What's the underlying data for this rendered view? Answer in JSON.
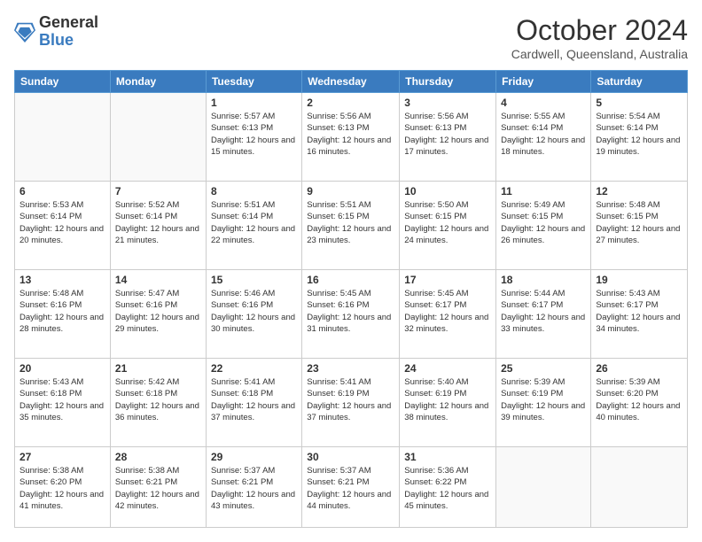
{
  "logo": {
    "general": "General",
    "blue": "Blue"
  },
  "header": {
    "month": "October 2024",
    "location": "Cardwell, Queensland, Australia"
  },
  "days_of_week": [
    "Sunday",
    "Monday",
    "Tuesday",
    "Wednesday",
    "Thursday",
    "Friday",
    "Saturday"
  ],
  "weeks": [
    [
      {
        "day": "",
        "info": ""
      },
      {
        "day": "",
        "info": ""
      },
      {
        "day": "1",
        "info": "Sunrise: 5:57 AM\nSunset: 6:13 PM\nDaylight: 12 hours and 15 minutes."
      },
      {
        "day": "2",
        "info": "Sunrise: 5:56 AM\nSunset: 6:13 PM\nDaylight: 12 hours and 16 minutes."
      },
      {
        "day": "3",
        "info": "Sunrise: 5:56 AM\nSunset: 6:13 PM\nDaylight: 12 hours and 17 minutes."
      },
      {
        "day": "4",
        "info": "Sunrise: 5:55 AM\nSunset: 6:14 PM\nDaylight: 12 hours and 18 minutes."
      },
      {
        "day": "5",
        "info": "Sunrise: 5:54 AM\nSunset: 6:14 PM\nDaylight: 12 hours and 19 minutes."
      }
    ],
    [
      {
        "day": "6",
        "info": "Sunrise: 5:53 AM\nSunset: 6:14 PM\nDaylight: 12 hours and 20 minutes."
      },
      {
        "day": "7",
        "info": "Sunrise: 5:52 AM\nSunset: 6:14 PM\nDaylight: 12 hours and 21 minutes."
      },
      {
        "day": "8",
        "info": "Sunrise: 5:51 AM\nSunset: 6:14 PM\nDaylight: 12 hours and 22 minutes."
      },
      {
        "day": "9",
        "info": "Sunrise: 5:51 AM\nSunset: 6:15 PM\nDaylight: 12 hours and 23 minutes."
      },
      {
        "day": "10",
        "info": "Sunrise: 5:50 AM\nSunset: 6:15 PM\nDaylight: 12 hours and 24 minutes."
      },
      {
        "day": "11",
        "info": "Sunrise: 5:49 AM\nSunset: 6:15 PM\nDaylight: 12 hours and 26 minutes."
      },
      {
        "day": "12",
        "info": "Sunrise: 5:48 AM\nSunset: 6:15 PM\nDaylight: 12 hours and 27 minutes."
      }
    ],
    [
      {
        "day": "13",
        "info": "Sunrise: 5:48 AM\nSunset: 6:16 PM\nDaylight: 12 hours and 28 minutes."
      },
      {
        "day": "14",
        "info": "Sunrise: 5:47 AM\nSunset: 6:16 PM\nDaylight: 12 hours and 29 minutes."
      },
      {
        "day": "15",
        "info": "Sunrise: 5:46 AM\nSunset: 6:16 PM\nDaylight: 12 hours and 30 minutes."
      },
      {
        "day": "16",
        "info": "Sunrise: 5:45 AM\nSunset: 6:16 PM\nDaylight: 12 hours and 31 minutes."
      },
      {
        "day": "17",
        "info": "Sunrise: 5:45 AM\nSunset: 6:17 PM\nDaylight: 12 hours and 32 minutes."
      },
      {
        "day": "18",
        "info": "Sunrise: 5:44 AM\nSunset: 6:17 PM\nDaylight: 12 hours and 33 minutes."
      },
      {
        "day": "19",
        "info": "Sunrise: 5:43 AM\nSunset: 6:17 PM\nDaylight: 12 hours and 34 minutes."
      }
    ],
    [
      {
        "day": "20",
        "info": "Sunrise: 5:43 AM\nSunset: 6:18 PM\nDaylight: 12 hours and 35 minutes."
      },
      {
        "day": "21",
        "info": "Sunrise: 5:42 AM\nSunset: 6:18 PM\nDaylight: 12 hours and 36 minutes."
      },
      {
        "day": "22",
        "info": "Sunrise: 5:41 AM\nSunset: 6:18 PM\nDaylight: 12 hours and 37 minutes."
      },
      {
        "day": "23",
        "info": "Sunrise: 5:41 AM\nSunset: 6:19 PM\nDaylight: 12 hours and 37 minutes."
      },
      {
        "day": "24",
        "info": "Sunrise: 5:40 AM\nSunset: 6:19 PM\nDaylight: 12 hours and 38 minutes."
      },
      {
        "day": "25",
        "info": "Sunrise: 5:39 AM\nSunset: 6:19 PM\nDaylight: 12 hours and 39 minutes."
      },
      {
        "day": "26",
        "info": "Sunrise: 5:39 AM\nSunset: 6:20 PM\nDaylight: 12 hours and 40 minutes."
      }
    ],
    [
      {
        "day": "27",
        "info": "Sunrise: 5:38 AM\nSunset: 6:20 PM\nDaylight: 12 hours and 41 minutes."
      },
      {
        "day": "28",
        "info": "Sunrise: 5:38 AM\nSunset: 6:21 PM\nDaylight: 12 hours and 42 minutes."
      },
      {
        "day": "29",
        "info": "Sunrise: 5:37 AM\nSunset: 6:21 PM\nDaylight: 12 hours and 43 minutes."
      },
      {
        "day": "30",
        "info": "Sunrise: 5:37 AM\nSunset: 6:21 PM\nDaylight: 12 hours and 44 minutes."
      },
      {
        "day": "31",
        "info": "Sunrise: 5:36 AM\nSunset: 6:22 PM\nDaylight: 12 hours and 45 minutes."
      },
      {
        "day": "",
        "info": ""
      },
      {
        "day": "",
        "info": ""
      }
    ]
  ]
}
